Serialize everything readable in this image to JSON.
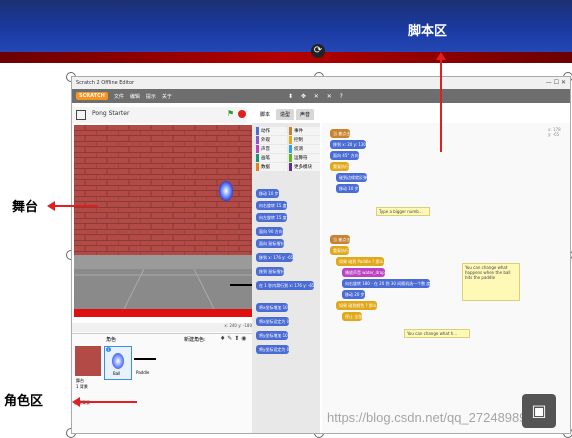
{
  "callouts": {
    "script_area": "脚本区",
    "stage": "舞台",
    "sprite_area": "角色区"
  },
  "window": {
    "title": "Scratch 2 Offline Editor",
    "logo": "SCRATCH",
    "menus": [
      "文件",
      "编辑",
      "提示",
      "关于"
    ],
    "project_title": "Pong Starter",
    "tabs": [
      "脚本",
      "造型",
      "声音"
    ],
    "coords": "x: 240  y: -180",
    "sprite_xy": "x: 178\ny: -65"
  },
  "categories": [
    {
      "label": "动作",
      "color": "#4a6cd4"
    },
    {
      "label": "事件",
      "color": "#c88330"
    },
    {
      "label": "外观",
      "color": "#8a55d7"
    },
    {
      "label": "控制",
      "color": "#e1a91a"
    },
    {
      "label": "声音",
      "color": "#bb42c3"
    },
    {
      "label": "侦测",
      "color": "#2ca5e2"
    },
    {
      "label": "画笔",
      "color": "#0e9a6c"
    },
    {
      "label": "运算符",
      "color": "#5cb712"
    },
    {
      "label": "数据",
      "color": "#ee7d16"
    },
    {
      "label": "更多模块",
      "color": "#632d99"
    }
  ],
  "palette": [
    "移动 10 步",
    "向右旋转 15 度",
    "向左旋转 15 度",
    "面向 90 方向",
    "面向 鼠标指针",
    "移到 x: 176 y: -65",
    "移到 鼠标指针",
    "在 1 秒内滑行到 x: 176 y: -65",
    "将x坐标增加 10",
    "将x坐标设定为 0",
    "将y坐标增加 10",
    "将y坐标设定为 0"
  ],
  "scripts": {
    "s1": [
      "当 被点击",
      "移到 x: 20 y: 130",
      "面向 45° 方向",
      "重复执行",
      "碰到边缘就反弹",
      "移动 10 步"
    ],
    "note1": "Type a bigger numb...",
    "s2": [
      "当 被点击",
      "重复执行",
      "如果 碰到 Paddle ? 那么",
      "播放声音 water_drop",
      "向右旋转 180 - 在 20 到 30 间随机选一个数 度",
      "移动 20 步",
      "如果 碰到颜色 ? 那么",
      "停止 全部"
    ],
    "note2": "You can change what happens when the ball hits the paddle",
    "note3": "You can change what h..."
  },
  "sprites": {
    "header": "角色",
    "new_sprite": "新建角色:",
    "stage_label": "舞台\n1 背景",
    "new_backdrop": "新建背景",
    "items": [
      "Ball",
      "Paddle"
    ]
  },
  "watermark": "https://blog.csdn.net/qq_27248989"
}
